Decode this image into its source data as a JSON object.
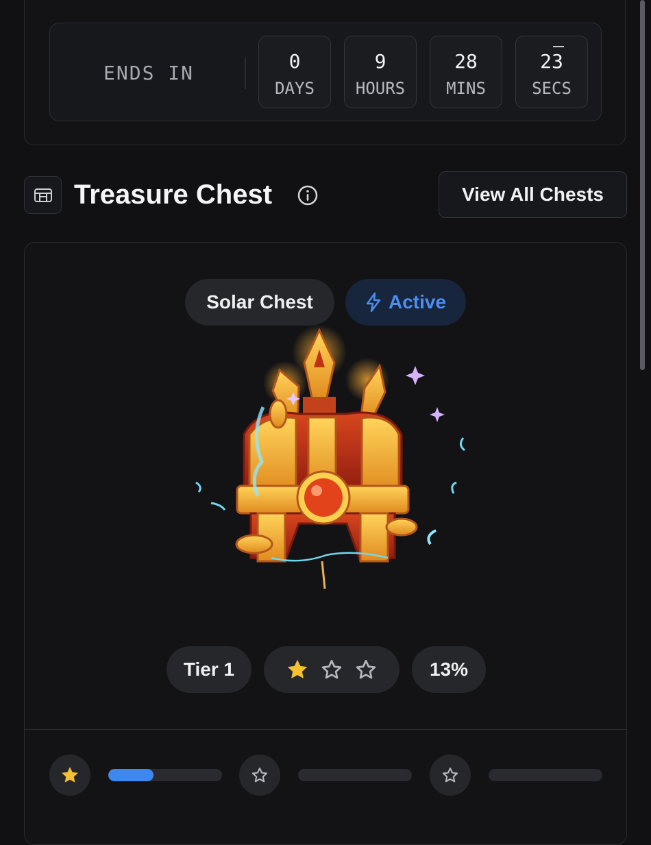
{
  "countdown": {
    "label": "ENDS IN",
    "units": [
      {
        "value": "0",
        "label": "DAYS"
      },
      {
        "value": "9",
        "label": "HOURS"
      },
      {
        "value": "28",
        "label": "MINS"
      },
      {
        "value": "23",
        "label": "SECS"
      }
    ]
  },
  "header": {
    "title": "Treasure Chest",
    "view_all_label": "View All Chests",
    "icons": {
      "section": "chest-grid-icon",
      "info": "info-icon"
    }
  },
  "chest": {
    "name": "Solar Chest",
    "status": "Active",
    "status_color": "#4c8ff0",
    "tier_label": "Tier 1",
    "stars_filled": 1,
    "stars_total": 3,
    "progress_text": "13%",
    "star_color": "#f5c12e"
  },
  "tiers": [
    {
      "icon": "star-filled-icon",
      "progress": 0.4
    },
    {
      "icon": "star-outline-icon",
      "progress": 0
    },
    {
      "icon": "star-outline-icon",
      "progress": 0
    }
  ]
}
